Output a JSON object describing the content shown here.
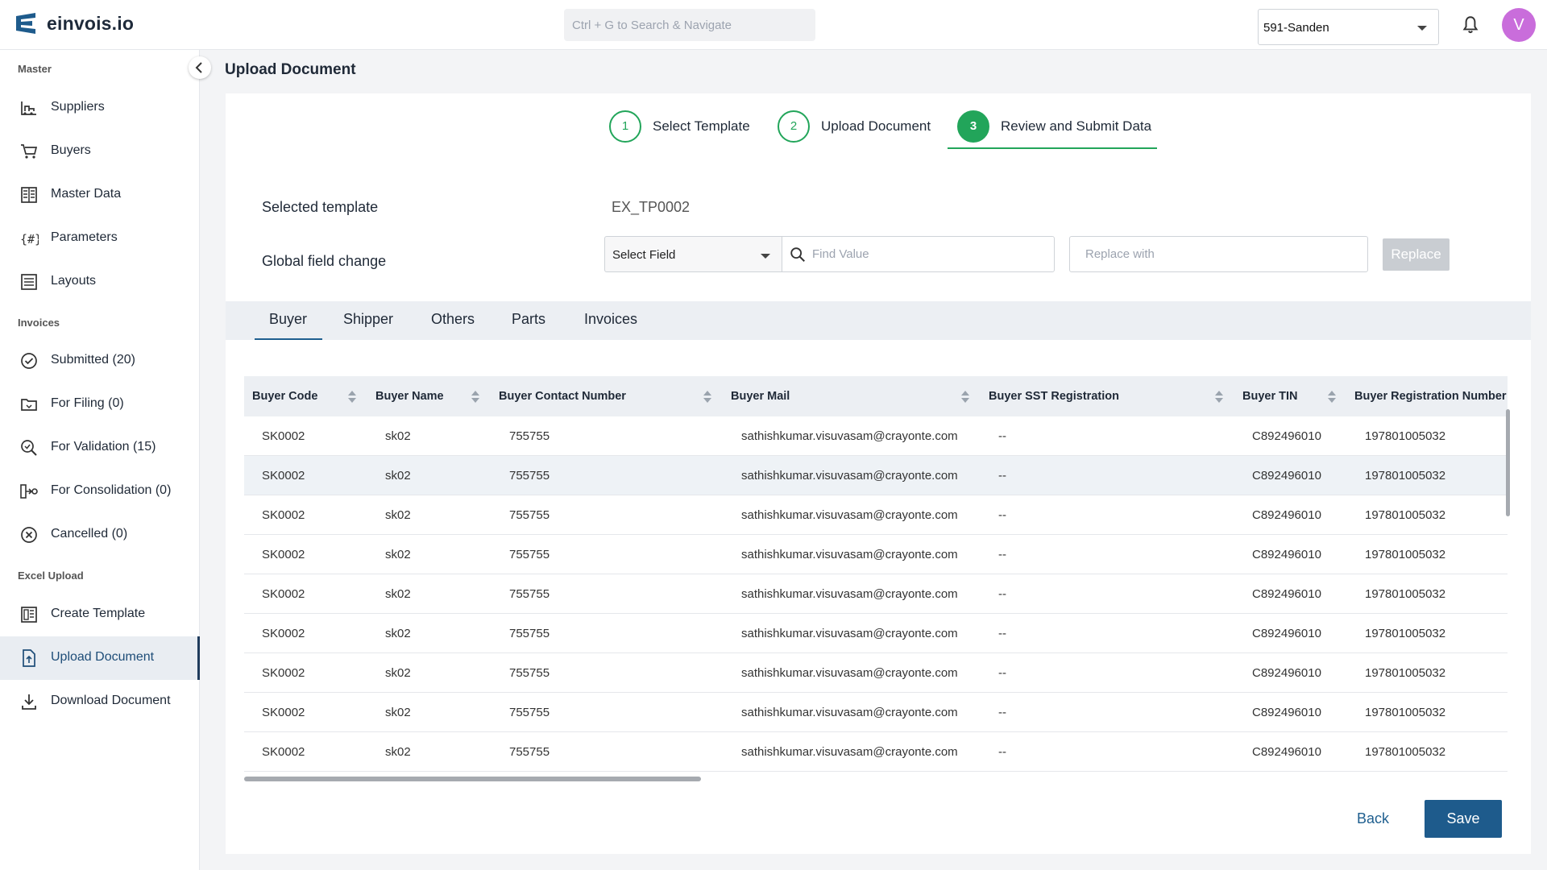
{
  "app": {
    "logo_text": "einvois.io",
    "search_placeholder": "Ctrl + G to Search & Navigate",
    "org_selected": "591-Sanden",
    "avatar_initial": "V",
    "accent_color": "#1e5b8c",
    "success_color": "#22a55a"
  },
  "sidebar": {
    "sections": {
      "master": "Master",
      "invoices": "Invoices",
      "excel_upload": "Excel Upload"
    },
    "items": [
      {
        "label": "Suppliers",
        "icon": "suppliers-icon"
      },
      {
        "label": "Buyers",
        "icon": "cart-icon"
      },
      {
        "label": "Master Data",
        "icon": "master-data-icon"
      },
      {
        "label": "Parameters",
        "icon": "parameters-icon"
      },
      {
        "label": "Layouts",
        "icon": "layouts-icon"
      },
      {
        "label": "Submitted (20)",
        "icon": "check-circle-icon"
      },
      {
        "label": "For Filing (0)",
        "icon": "folder-icon"
      },
      {
        "label": "For Validation (15)",
        "icon": "search-check-icon"
      },
      {
        "label": "For Consolidation (0)",
        "icon": "consolidation-icon"
      },
      {
        "label": "Cancelled (0)",
        "icon": "cancel-circle-icon"
      },
      {
        "label": "Create Template",
        "icon": "template-icon"
      },
      {
        "label": "Upload Document",
        "icon": "upload-file-icon"
      },
      {
        "label": "Download Document",
        "icon": "download-icon"
      }
    ]
  },
  "main": {
    "page_title": "Upload Document",
    "steps": [
      {
        "number": "1",
        "label": "Select Template"
      },
      {
        "number": "2",
        "label": "Upload Document"
      },
      {
        "number": "3",
        "label": "Review and Submit Data"
      }
    ],
    "selected_template_label": "Selected template",
    "selected_template_value": "EX_TP0002",
    "global_field_change_label": "Global field change",
    "select_field_value": "Select Field",
    "find_placeholder": "Find Value",
    "replace_placeholder": "Replace with",
    "replace_button": "Replace",
    "tabs": [
      "Buyer",
      "Shipper",
      "Others",
      "Parts",
      "Invoices"
    ],
    "back_button": "Back",
    "save_button": "Save"
  },
  "table": {
    "columns": [
      "Buyer Code",
      "Buyer Name",
      "Buyer Contact Number",
      "Buyer Mail",
      "Buyer SST Registration",
      "Buyer TIN",
      "Buyer Registration Number"
    ],
    "rows": [
      [
        "SK0002",
        "sk02",
        "755755",
        "sathishkumar.visuvasam@crayonte.com",
        "--",
        "C892496010",
        "197801005032"
      ],
      [
        "SK0002",
        "sk02",
        "755755",
        "sathishkumar.visuvasam@crayonte.com",
        "--",
        "C892496010",
        "197801005032"
      ],
      [
        "SK0002",
        "sk02",
        "755755",
        "sathishkumar.visuvasam@crayonte.com",
        "--",
        "C892496010",
        "197801005032"
      ],
      [
        "SK0002",
        "sk02",
        "755755",
        "sathishkumar.visuvasam@crayonte.com",
        "--",
        "C892496010",
        "197801005032"
      ],
      [
        "SK0002",
        "sk02",
        "755755",
        "sathishkumar.visuvasam@crayonte.com",
        "--",
        "C892496010",
        "197801005032"
      ],
      [
        "SK0002",
        "sk02",
        "755755",
        "sathishkumar.visuvasam@crayonte.com",
        "--",
        "C892496010",
        "197801005032"
      ],
      [
        "SK0002",
        "sk02",
        "755755",
        "sathishkumar.visuvasam@crayonte.com",
        "--",
        "C892496010",
        "197801005032"
      ],
      [
        "SK0002",
        "sk02",
        "755755",
        "sathishkumar.visuvasam@crayonte.com",
        "--",
        "C892496010",
        "197801005032"
      ],
      [
        "SK0002",
        "sk02",
        "755755",
        "sathishkumar.visuvasam@crayonte.com",
        "--",
        "C892496010",
        "197801005032"
      ]
    ]
  }
}
